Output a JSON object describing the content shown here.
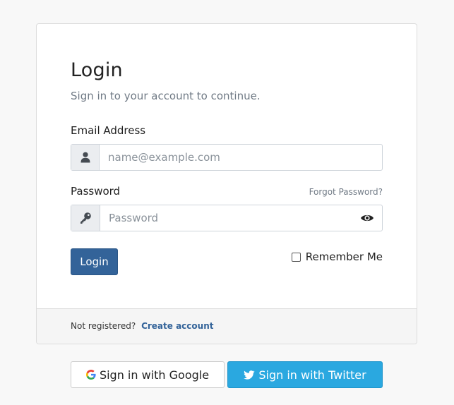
{
  "login": {
    "title": "Login",
    "subtitle": "Sign in to your account to continue.",
    "email_label": "Email Address",
    "email_placeholder": "name@example.com",
    "email_value": "",
    "password_label": "Password",
    "forgot_password": "Forgot Password?",
    "password_placeholder": "Password",
    "password_value": "",
    "login_button": "Login",
    "remember_me": "Remember Me",
    "remember_checked": false
  },
  "footer": {
    "text": "Not registered?",
    "create_account": "Create account"
  },
  "social": {
    "google": "Sign in with Google",
    "twitter": "Sign in with Twitter"
  },
  "icons": {
    "email_addon": "user-icon",
    "password_addon": "key-icon",
    "password_toggle": "eye-icon",
    "google": "google-icon",
    "twitter": "twitter-icon"
  },
  "colors": {
    "primary": "#336399",
    "twitter": "#2aa8e0",
    "muted": "#707a85",
    "background": "#f8f8f8"
  }
}
